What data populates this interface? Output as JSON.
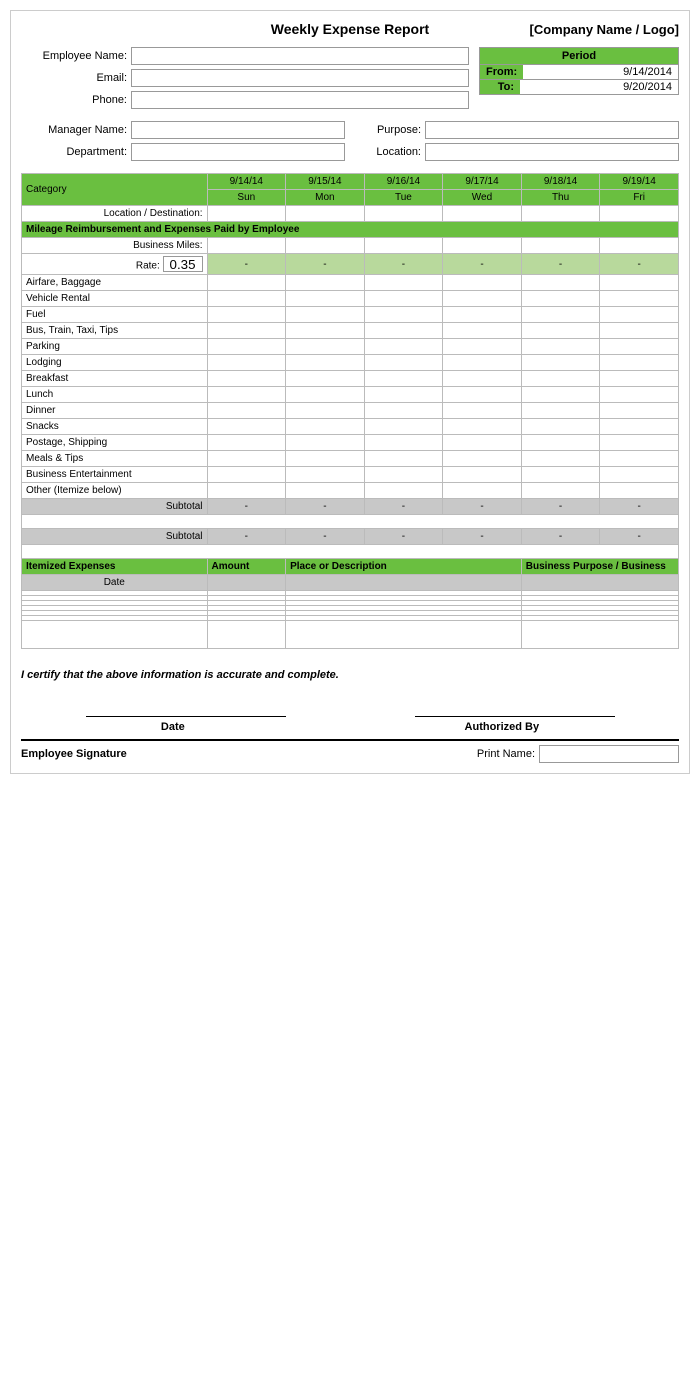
{
  "header": {
    "title": "Weekly Expense Report",
    "company": "[Company Name / Logo]"
  },
  "form": {
    "employee_name_label": "Employee Name:",
    "email_label": "Email:",
    "phone_label": "Phone:",
    "manager_label": "Manager Name:",
    "department_label": "Department:",
    "purpose_label": "Purpose:",
    "location_label": "Location:"
  },
  "period": {
    "title": "Period",
    "from_label": "From:",
    "from_value": "9/14/2014",
    "to_label": "To:",
    "to_value": "9/20/2014"
  },
  "table": {
    "category_label": "Category",
    "location_destination": "Location / Destination:",
    "dates": [
      "9/14/14",
      "9/15/14",
      "9/16/14",
      "9/17/14",
      "9/18/14",
      "9/19/14"
    ],
    "days": [
      "Sun",
      "Mon",
      "Tue",
      "Wed",
      "Thu",
      "Fri"
    ],
    "mileage_section": "Mileage Reimbursement and Expenses Paid by Employee",
    "business_miles_label": "Business Miles:",
    "rate_label": "Rate:",
    "rate_value": "0.35",
    "categories": [
      "Airfare, Baggage",
      "Vehicle Rental",
      "Fuel",
      "Bus, Train, Taxi, Tips",
      "Parking",
      "Lodging",
      "Breakfast",
      "Lunch",
      "Dinner",
      "Snacks",
      "Postage, Shipping",
      "Meals & Tips",
      "Business Entertainment",
      "Other (Itemize below)"
    ],
    "subtotal_label": "Subtotal",
    "dash": "-"
  },
  "itemized": {
    "header": "Itemized Expenses",
    "amount_col": "Amount",
    "place_col": "Place or Description",
    "purpose_col": "Business Purpose / Business",
    "date_col": "Date",
    "rows": 7
  },
  "certify": {
    "text": "I certify that the above information is accurate and complete."
  },
  "signature": {
    "date_label": "Date",
    "authorized_label": "Authorized By",
    "employee_sig_label": "Employee Signature",
    "print_name_label": "Print Name:"
  }
}
